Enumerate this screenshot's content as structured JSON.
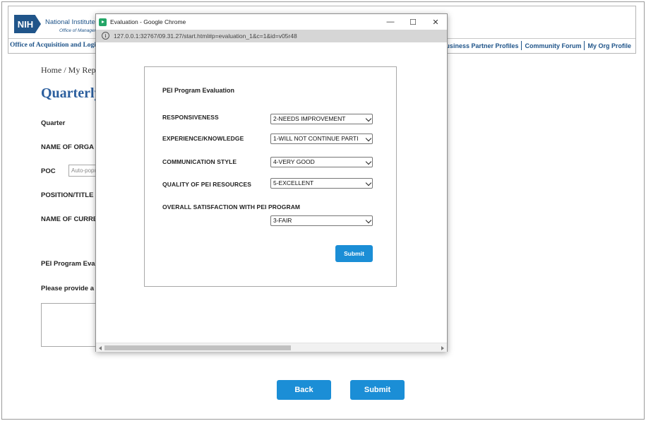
{
  "header": {
    "logo_text": "NIH",
    "org_name": "National Institutes of",
    "org_sub": "Office of Management",
    "left_link": "Office of Acquisition and Logi",
    "nav_links": [
      "CU/Business Partner Profiles",
      "Community Forum",
      "My Org Profile"
    ],
    "brand_color": "#20558a"
  },
  "page": {
    "breadcrumb": "Home  /  My Rep",
    "title": "Quarterly",
    "labels": {
      "quarter": "Quarter",
      "org_name": "NAME OF ORGA",
      "poc": "POC",
      "position": "POSITION/TITLE",
      "current": "NAME OF CURRE",
      "pei_eval": "PEI Program Eva",
      "please_provide": "Please provide a"
    },
    "poc_placeholder": "Auto-popu",
    "back_button": "Back",
    "submit_button": "Submit"
  },
  "popup": {
    "window_title": "Evaluation - Google Chrome",
    "controls": {
      "minimize": "—",
      "maximize": "☐",
      "close": "✕"
    },
    "url": "127.0.0.1:32767/09.31.27/start.html#p=evaluation_1&c=1&id=v05r48",
    "form": {
      "heading": "PEI Program Evaluation",
      "questions": [
        {
          "label": "RESPONSIVENESS",
          "value": "2-NEEDS IMPROVEMENT"
        },
        {
          "label": "EXPERIENCE/KNOWLEDGE",
          "value": "1-WILL NOT CONTINUE PARTI"
        },
        {
          "label": "COMMUNICATION STYLE",
          "value": "4-VERY GOOD"
        },
        {
          "label": "QUALITY OF PEI RESOURCES",
          "value": "5-EXCELLENT"
        },
        {
          "label": "OVERALL SATISFACTION WITH PEI PROGRAM",
          "value": "3-FAIR"
        }
      ],
      "submit_label": "Submit"
    }
  },
  "colors": {
    "accent": "#1b8ed6",
    "title": "#2c5f9e"
  }
}
